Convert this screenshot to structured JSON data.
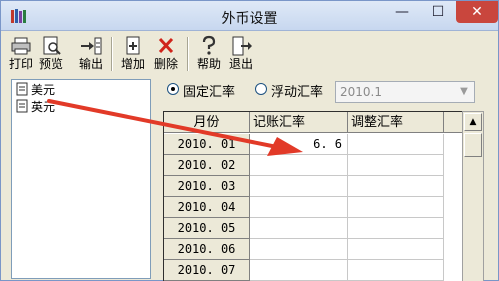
{
  "window": {
    "title": "外币设置",
    "close_glyph": "✕",
    "min_glyph": "—",
    "max_glyph": "☐"
  },
  "toolbar": {
    "buttons": [
      {
        "label": "打印",
        "icon": "printer-icon"
      },
      {
        "label": "预览",
        "icon": "preview-icon"
      },
      {
        "label": "输出",
        "icon": "export-icon"
      },
      {
        "label": "增加",
        "icon": "add-icon"
      },
      {
        "label": "删除",
        "icon": "delete-icon"
      },
      {
        "label": "帮助",
        "icon": "help-icon"
      },
      {
        "label": "退出",
        "icon": "exit-icon"
      }
    ]
  },
  "currencies": [
    {
      "name": "美元"
    },
    {
      "name": "英元"
    }
  ],
  "rate_mode": {
    "fixed_label": "固定汇率",
    "floating_label": "浮动汇率",
    "selected": "fixed",
    "period_value": "2010.1"
  },
  "grid": {
    "headers": {
      "month": "月份",
      "book_rate": "记账汇率",
      "adjust_rate": "调整汇率"
    },
    "rows": [
      {
        "month": "2010. 01",
        "book_rate": "6. 6",
        "adjust_rate": ""
      },
      {
        "month": "2010. 02",
        "book_rate": "",
        "adjust_rate": ""
      },
      {
        "month": "2010. 03",
        "book_rate": "",
        "adjust_rate": ""
      },
      {
        "month": "2010. 04",
        "book_rate": "",
        "adjust_rate": ""
      },
      {
        "month": "2010. 05",
        "book_rate": "",
        "adjust_rate": ""
      },
      {
        "month": "2010. 06",
        "book_rate": "",
        "adjust_rate": ""
      },
      {
        "month": "2010. 07",
        "book_rate": "",
        "adjust_rate": ""
      }
    ]
  },
  "colors": {
    "annotation_arrow": "#e23a28",
    "close_button": "#c9463d",
    "window_bg": "#ece9d8"
  }
}
